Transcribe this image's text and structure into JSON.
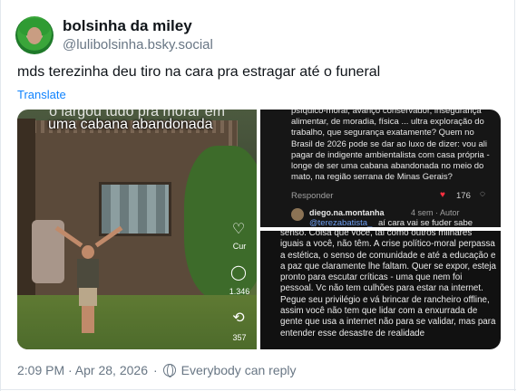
{
  "author": {
    "display_name": "bolsinha da miley",
    "handle": "@lulibolsinha.bsky.social"
  },
  "post": {
    "text": "mds terezinha deu tiro na cara pra estragar até o funeral",
    "translate_label": "Translate"
  },
  "media": {
    "left": {
      "caption_top": "o largou tudo pra morar em",
      "caption": "uma cabana abandonada",
      "like_count": "Cur",
      "comment_count": "1.346",
      "repost_count": "357"
    },
    "right_top": {
      "text": "psíquico-moral, avanço conservador, insegurança alimentar, de moradia, física ... ultra exploração do trabalho, que segurança exatamente? Quem no Brasil de 2026 pode se dar ao luxo de dizer: vou ali pagar de indigente ambientalista com casa própria - longe de ser uma cabana abandonada no meio do mato, na região serrana de Minas Gerais?",
      "reply_label": "Responder",
      "like_count": "176",
      "reply_author": "diego.na.montanha",
      "reply_meta": "4 sem · Autor",
      "reply_mention": "@terezabatista_",
      "reply_text": "aí cara vai se fuder sabe"
    },
    "right_bottom": {
      "text": "senso. Coisa que você, tal como outros milhares iguais a você, não têm. A crise político-moral perpassa a estética, o senso de comunidade e até a educação e a paz que claramente lhe faltam. Quer se expor, esteja pronto para escutar críticas - uma que nem foi pessoal. Vc não tem culhões para estar na internet. Pegue seu privilégio e vá brincar de rancheiro offline, assim você não tem que lidar com a enxurrada de gente que usa a internet não para se validar, mas para entender esse desastre de realidade"
    }
  },
  "footer": {
    "timestamp": "2:09 PM · Apr 28, 2026",
    "separator": "·",
    "visibility": "Everybody can reply"
  },
  "colors": {
    "link": "#1083fe",
    "muted": "#687684",
    "heart": "#ff3040"
  }
}
